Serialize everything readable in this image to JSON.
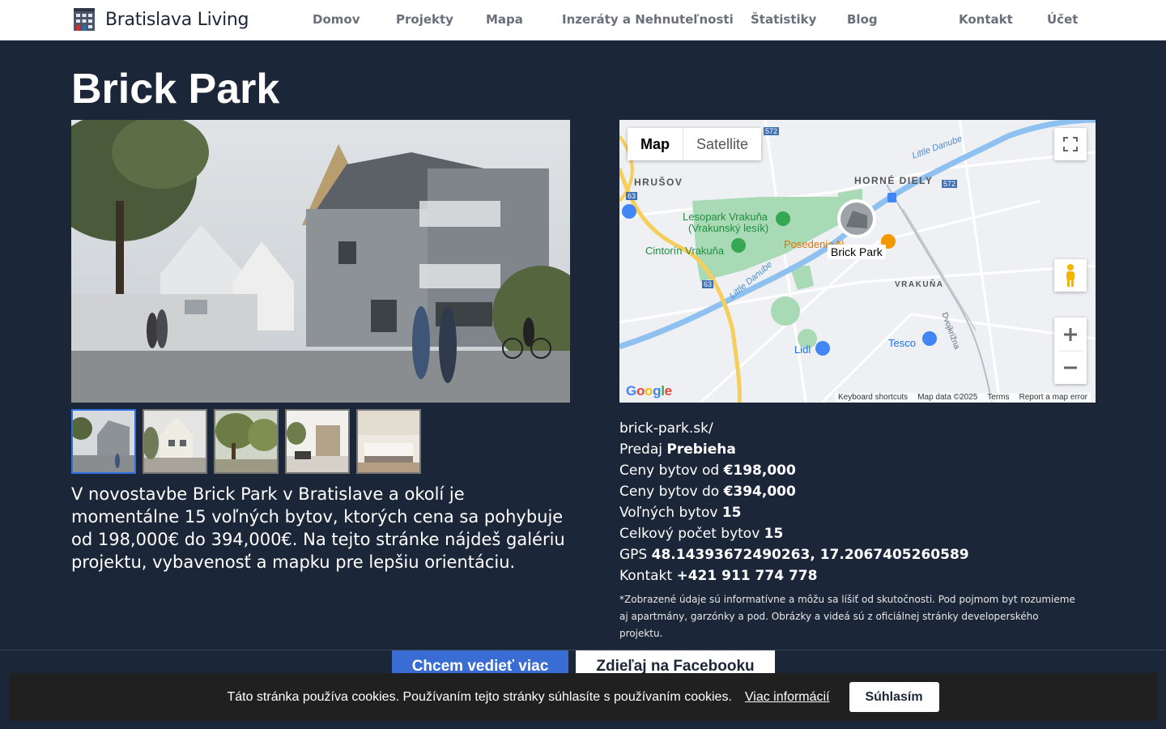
{
  "header": {
    "logo_text": "Bratislava Living",
    "nav": {
      "home": "Domov",
      "projects": "Projekty",
      "map": "Mapa",
      "listings": "Inzeráty a Nehnuteľnosti",
      "stats": "Štatistiky",
      "blog": "Blog",
      "contact": "Kontakt",
      "account": "Účet"
    }
  },
  "project": {
    "title": "Brick Park",
    "description": "V novostavbe Brick Park v Bratislave a okolí je momentálne 15 voľných bytov, ktorých cena sa pohybuje od 198,000€ do 394,000€. Na tejto stránke nájdeš galériu projektu, vybavenosť a mapku pre lepšiu orientáciu.",
    "thumbnails_count": 5
  },
  "map": {
    "type_map": "Map",
    "type_satellite": "Satellite",
    "marker_label": "Brick Park",
    "labels": {
      "hrusov": "HRUŠOV",
      "horne_diely": "HORNÉ DIELY",
      "vrakuna": "VRAKUŇA",
      "lesopark_1": "Lesopark Vrakuňa",
      "lesopark_2": "(Vrakunský lesík)",
      "cintorin": "Cintorín Vrakuňa",
      "posedenie": "Posedenie N",
      "lidl": "Lidl",
      "tesco": "Tesco",
      "little_danube_1": "Little Danube",
      "little_danube_2": "Little Danube",
      "dvojkrizna": "Dvojkrížna",
      "road_572a": "572",
      "road_572b": "572",
      "road_63a": "63",
      "road_63b": "63"
    },
    "footer": {
      "shortcuts": "Keyboard shortcuts",
      "data": "Map data ©2025",
      "terms": "Terms",
      "report": "Report a map error"
    },
    "google": "Google"
  },
  "info": {
    "website": "brick-park.sk/",
    "sale_label": "Predaj",
    "sale_value": "Prebieha",
    "price_from_label": "Ceny bytov od",
    "price_from_value": "€198,000",
    "price_to_label": "Ceny bytov do",
    "price_to_value": "€394,000",
    "free_label": "Voľných bytov",
    "free_value": "15",
    "total_label": "Celkový počet bytov",
    "total_value": "15",
    "gps_label": "GPS",
    "gps_value": "48.14393672490263, 17.2067405260589",
    "contact_label": "Kontakt",
    "contact_value": "+421 911 774 778",
    "disclaimer": "*Zobrazené údaje sú informatívne a môžu sa líšiť od skutočnosti. Pod pojmom byt rozumieme aj apartmány, garzónky a pod. Obrázky a videá sú z oficiálnej stránky developerského projektu."
  },
  "actions": {
    "learn_more": "Chcem vedieť viac",
    "share_facebook": "Zdieľaj na Facebooku"
  },
  "cookie": {
    "text": "Táto stránka používa cookies. Používaním tejto stránky súhlasíte s používaním cookies.",
    "link": "Viac informácií",
    "accept": "Súhlasím"
  },
  "colors": {
    "background": "#1b2639",
    "primary_button": "#3a6dd3",
    "thumb_active_border": "#2f6fdf"
  }
}
